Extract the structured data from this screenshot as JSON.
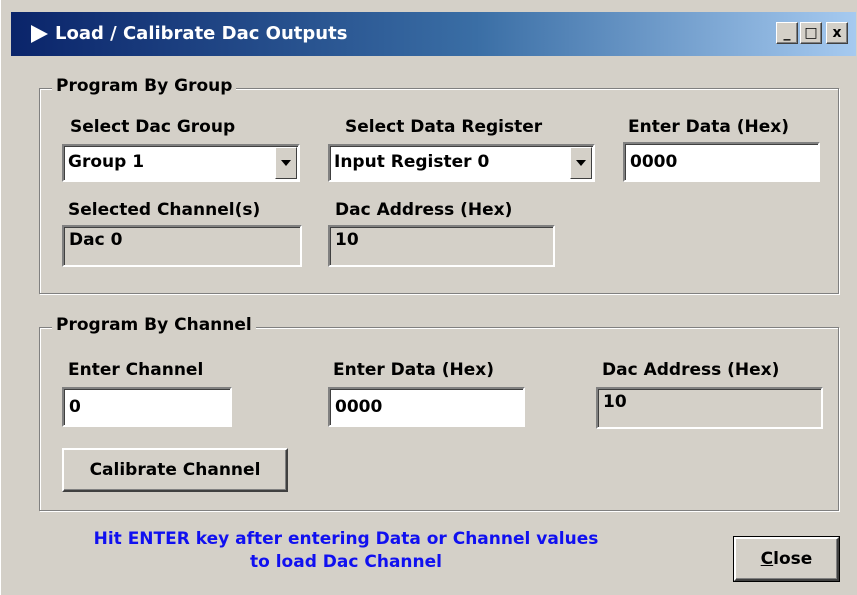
{
  "window": {
    "title": "Load / Calibrate Dac Outputs",
    "controls": {
      "minimize": "_",
      "maximize": "□",
      "close": "x"
    }
  },
  "group_section": {
    "title": "Program By Group",
    "select_dac_group": {
      "label": "Select Dac Group",
      "value": "Group 1"
    },
    "select_data_register": {
      "label": "Select Data Register",
      "value": "Input Register 0"
    },
    "enter_data": {
      "label": "Enter Data (Hex)",
      "value": "0000"
    },
    "selected_channels": {
      "label": "Selected Channel(s)",
      "value": "Dac 0"
    },
    "dac_address": {
      "label": "Dac Address (Hex)",
      "value": "10"
    }
  },
  "channel_section": {
    "title": "Program By Channel",
    "enter_channel": {
      "label": "Enter Channel",
      "value": "0"
    },
    "enter_data": {
      "label": "Enter Data (Hex)",
      "value": "0000"
    },
    "dac_address": {
      "label": "Dac Address (Hex)",
      "value": "10"
    },
    "calibrate_button": "Calibrate Channel"
  },
  "hint": {
    "line1": "Hit ENTER key after entering Data or Channel values",
    "line2": "to load Dac Channel"
  },
  "close_button": {
    "accel": "C",
    "rest": "lose"
  },
  "icons": {
    "app": "play-arrow-icon",
    "dropdown": "chevron-down-icon"
  },
  "colors": {
    "titlebar_start": "#0a246a",
    "titlebar_end": "#a6caf0",
    "face": "#d4d0c8",
    "hint_text": "#1010f0"
  }
}
